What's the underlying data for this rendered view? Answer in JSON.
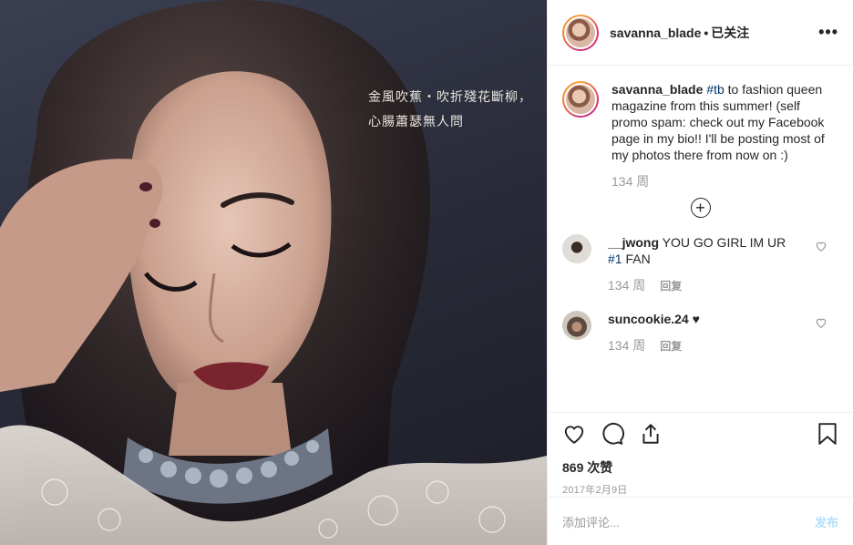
{
  "photo": {
    "alt_subject": "portrait photo",
    "overlay_text_line1": "金風吹蕉・吹折殘花斷柳，",
    "overlay_text_line2": "心腸蕭瑟無人問"
  },
  "header": {
    "username": "savanna_blade",
    "separator": "•",
    "follow_label": "已关注",
    "more_icon": "more-icon",
    "more_label": "•••"
  },
  "caption": {
    "username": "savanna_blade",
    "hashtag": "#tb",
    "text": " to fashion queen magazine from this summer! (self promo spam: check out my Facebook page in my bio!! I'll be posting most of my photos there from now on :)",
    "time": "134 周"
  },
  "load_more_label": "+",
  "comments": [
    {
      "username": "__jwong",
      "text_before": " YOU GO GIRL IM UR ",
      "hashtag": "#1",
      "text_after": " FAN",
      "time": "134 周",
      "reply_label": "回复"
    },
    {
      "username": "suncookie.24",
      "text_before": " ♥",
      "hashtag": "",
      "text_after": "",
      "time": "134 周",
      "reply_label": "回复"
    }
  ],
  "actions": {
    "likes": "869 次赞",
    "date": "2017年2月9日"
  },
  "add_comment": {
    "placeholder": "添加评论...",
    "post_label": "发布"
  },
  "colors": {
    "link": "#003569",
    "muted": "#999999",
    "post_disabled": "#b2dffc"
  }
}
